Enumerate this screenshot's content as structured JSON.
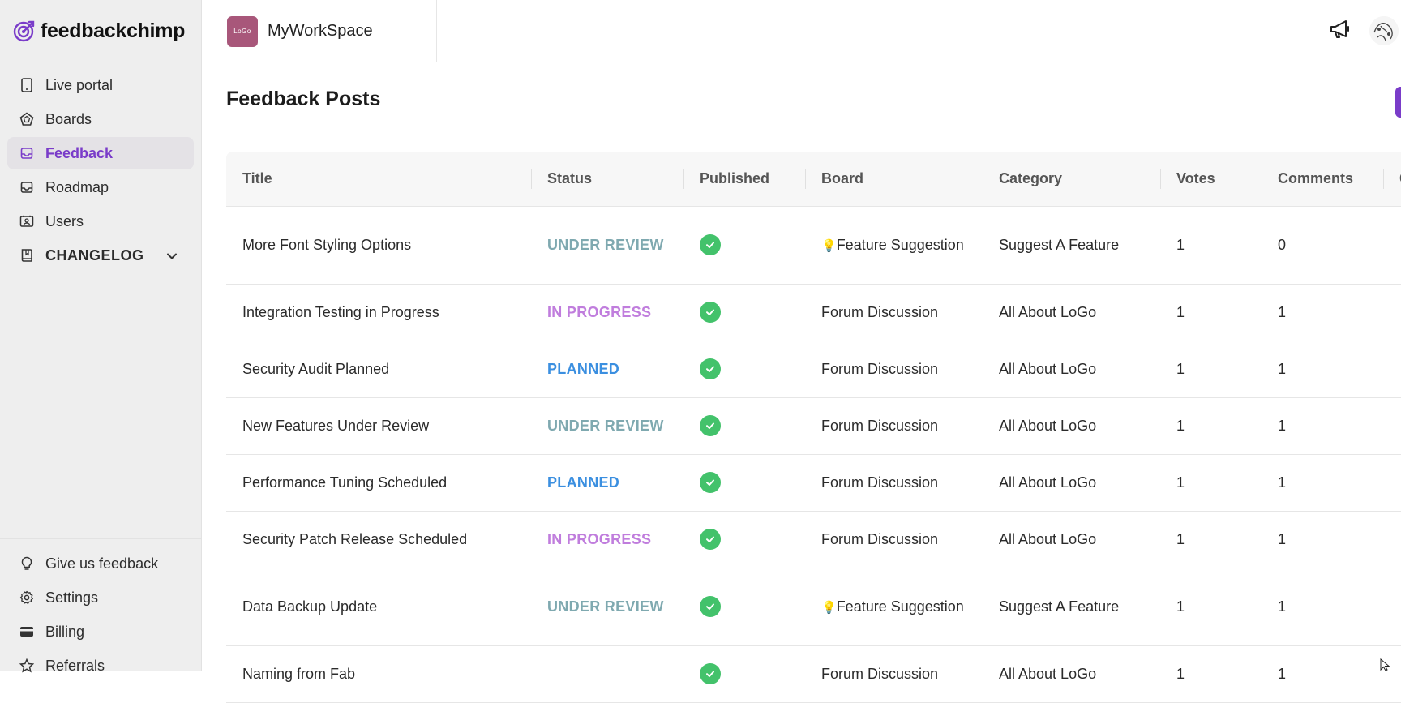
{
  "brand": {
    "name": "feedbackchimp"
  },
  "sidebar": {
    "items": [
      {
        "label": "Live portal",
        "icon": "tablet-icon"
      },
      {
        "label": "Boards",
        "icon": "pentagon-icon"
      },
      {
        "label": "Feedback",
        "icon": "inbox-icon",
        "active": true
      },
      {
        "label": "Roadmap",
        "icon": "inbox-icon"
      },
      {
        "label": "Users",
        "icon": "contact-card-icon"
      },
      {
        "label": "CHANGELOG",
        "icon": "book-icon"
      }
    ],
    "bottom_items": [
      {
        "label": "Give us feedback",
        "icon": "lightbulb-icon"
      },
      {
        "label": "Settings",
        "icon": "gear-icon"
      },
      {
        "label": "Billing",
        "icon": "credit-card-icon"
      },
      {
        "label": "Referrals",
        "icon": "star-icon"
      }
    ]
  },
  "header": {
    "workspace_name": "MyWorkSpace",
    "workspace_logo_text": "LoGo"
  },
  "main": {
    "title": "Feedback Posts",
    "columns": [
      "Title",
      "Status",
      "Published",
      "Board",
      "Category",
      "Votes",
      "Comments",
      "C"
    ],
    "rows": [
      {
        "title": "More Font Styling Options",
        "status": "UNDER REVIEW",
        "board_icon": "💡",
        "board": "Feature Suggestion",
        "category": "Suggest A Feature",
        "votes": "1",
        "comments": "0"
      },
      {
        "title": "Integration Testing in Progress",
        "status": "IN PROGRESS",
        "board_icon": "",
        "board": "Forum Discussion",
        "category": "All About LoGo",
        "votes": "1",
        "comments": "1"
      },
      {
        "title": "Security Audit Planned",
        "status": "PLANNED",
        "board_icon": "",
        "board": "Forum Discussion",
        "category": "All About LoGo",
        "votes": "1",
        "comments": "1"
      },
      {
        "title": "New Features Under Review",
        "status": "UNDER REVIEW",
        "board_icon": "",
        "board": "Forum Discussion",
        "category": "All About LoGo",
        "votes": "1",
        "comments": "1"
      },
      {
        "title": "Performance Tuning Scheduled",
        "status": "PLANNED",
        "board_icon": "",
        "board": "Forum Discussion",
        "category": "All About LoGo",
        "votes": "1",
        "comments": "1"
      },
      {
        "title": "Security Patch Release Scheduled",
        "status": "IN PROGRESS",
        "board_icon": "",
        "board": "Forum Discussion",
        "category": "All About LoGo",
        "votes": "1",
        "comments": "1"
      },
      {
        "title": "Data Backup Update",
        "status": "UNDER REVIEW",
        "board_icon": "💡",
        "board": "Feature Suggestion",
        "category": "Suggest A Feature",
        "votes": "1",
        "comments": "1"
      },
      {
        "title": "Naming from Fab",
        "status": "",
        "board_icon": "",
        "board": "Forum Discussion",
        "category": "All About LoGo",
        "votes": "1",
        "comments": "1"
      }
    ]
  },
  "colors": {
    "accent": "#7a3cc9",
    "under_review": "#7fa9b0",
    "in_progress": "#c07ddd",
    "planned": "#3b8fe0",
    "published_check": "#43c26b"
  }
}
